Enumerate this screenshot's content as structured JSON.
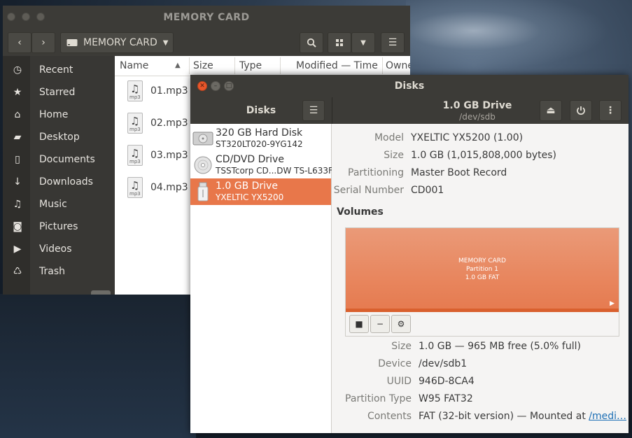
{
  "files": {
    "title": "MEMORY CARD",
    "path_label": "MEMORY CARD",
    "sidebar": [
      {
        "label": "Recent",
        "icon": "clock-icon"
      },
      {
        "label": "Starred",
        "icon": "star-icon"
      },
      {
        "label": "Home",
        "icon": "home-icon"
      },
      {
        "label": "Desktop",
        "icon": "folder-icon"
      },
      {
        "label": "Documents",
        "icon": "document-icon"
      },
      {
        "label": "Downloads",
        "icon": "download-icon"
      },
      {
        "label": "Music",
        "icon": "music-icon"
      },
      {
        "label": "Pictures",
        "icon": "camera-icon"
      },
      {
        "label": "Videos",
        "icon": "video-icon"
      },
      {
        "label": "Trash",
        "icon": "trash-icon"
      }
    ],
    "columns": {
      "name": "Name",
      "size": "Size",
      "type": "Type",
      "modified": "Modified — Time",
      "owner": "Owne"
    },
    "rows": [
      {
        "name": "01.mp3",
        "ext": "mp3"
      },
      {
        "name": "02.mp3",
        "ext": "mp3"
      },
      {
        "name": "03.mp3",
        "ext": "mp3"
      },
      {
        "name": "04.mp3",
        "ext": "mp3"
      }
    ]
  },
  "disks": {
    "title": "Disks",
    "panel_title": "Disks",
    "drive_title": "1.0 GB Drive",
    "drive_sub": "/dev/sdb",
    "devices": [
      {
        "name": "320 GB Hard Disk",
        "sub": "ST320LT020-9YG142",
        "icon": "hard-disk-icon"
      },
      {
        "name": "CD/DVD Drive",
        "sub": "TSSTcorp CD...DW TS-L633F",
        "icon": "optical-disc-icon"
      },
      {
        "name": "1.0 GB Drive",
        "sub": "YXELTIC YX5200",
        "icon": "usb-drive-icon"
      }
    ],
    "info": {
      "model_k": "Model",
      "model_v": "YXELTIC YX5200 (1.00)",
      "size_k": "Size",
      "size_v": "1.0 GB (1,015,808,000 bytes)",
      "part_k": "Partitioning",
      "part_v": "Master Boot Record",
      "serial_k": "Serial Number",
      "serial_v": "CD001"
    },
    "volumes_label": "Volumes",
    "partition": {
      "line1": "MEMORY CARD",
      "line2": "Partition 1",
      "line3": "1.0 GB FAT"
    },
    "vol": {
      "size_k": "Size",
      "size_v": "1.0 GB — 965 MB free (5.0% full)",
      "device_k": "Device",
      "device_v": "/dev/sdb1",
      "uuid_k": "UUID",
      "uuid_v": "946D-8CA4",
      "ptype_k": "Partition Type",
      "ptype_v": "W95 FAT32",
      "contents_k": "Contents",
      "contents_v": "FAT (32-bit version) — Mounted at ",
      "contents_link": "/medi…"
    }
  }
}
